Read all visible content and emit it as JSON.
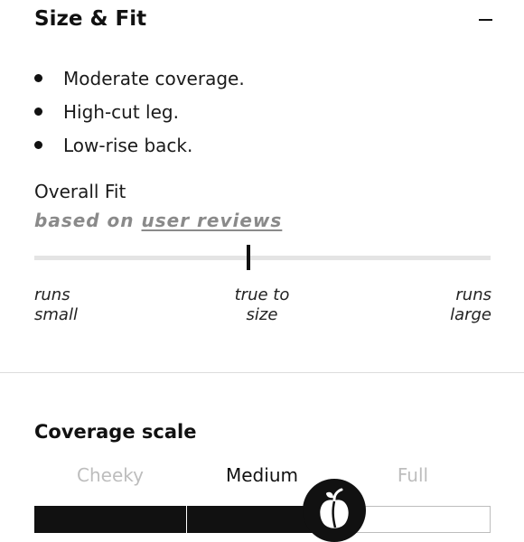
{
  "section": {
    "title": "Size & Fit",
    "collapse_icon": "minus-icon"
  },
  "features": [
    "Moderate coverage.",
    "High-cut leg.",
    "Low-rise back."
  ],
  "overall_fit": {
    "title": "Overall Fit",
    "based_on_prefix": "based on",
    "user_reviews_link": "user reviews",
    "marker_position": 0.47,
    "scale_left_line1": "runs",
    "scale_left_line2": "small",
    "scale_mid_line1": "true to",
    "scale_mid_line2": "size",
    "scale_right_line1": "runs",
    "scale_right_line2": "large"
  },
  "coverage": {
    "title": "Coverage scale",
    "options": [
      "Cheeky",
      "Medium",
      "Full"
    ],
    "selected": "Medium",
    "knob_icon": "peach-icon"
  },
  "colors": {
    "text": "#111111",
    "muted": "#bdbdbd",
    "track": "#e4e4e4",
    "subtitle": "#8a8a8a"
  }
}
